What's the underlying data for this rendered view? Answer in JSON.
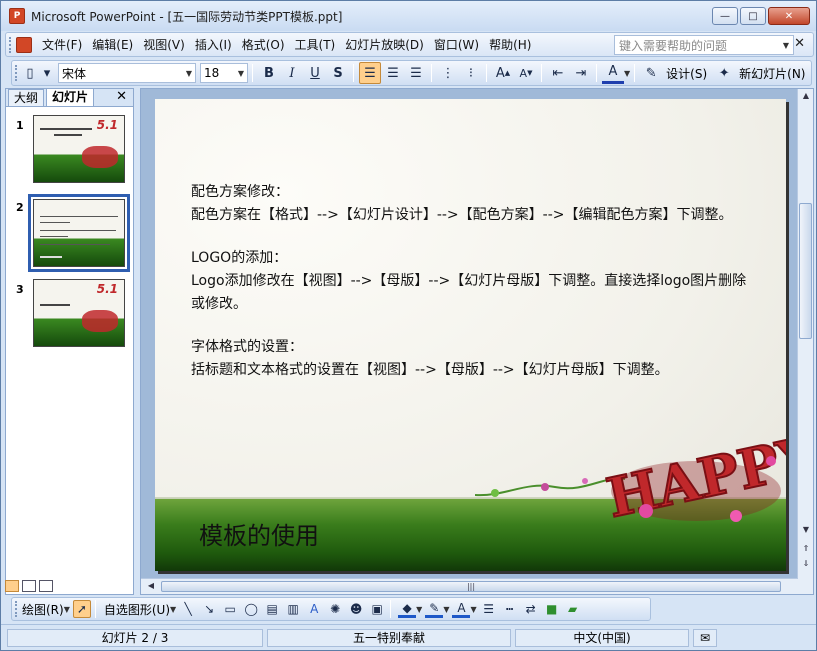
{
  "window": {
    "title": "Microsoft PowerPoint - [五一国际劳动节类PPT模板.ppt]",
    "app_icon": "P",
    "controls": {
      "minimize": "—",
      "maximize": "□",
      "close": "✕"
    }
  },
  "menubar": {
    "items": [
      "文件(F)",
      "编辑(E)",
      "视图(V)",
      "插入(I)",
      "格式(O)",
      "工具(T)",
      "幻灯片放映(D)",
      "窗口(W)",
      "帮助(H)"
    ],
    "help_placeholder": "键入需要帮助的问题",
    "close_glyph": "✕"
  },
  "toolbar": {
    "font_name": "宋体",
    "font_size": "18",
    "bold": "B",
    "italic": "I",
    "underline": "U",
    "shadow": "S",
    "design_label": "设计(S)",
    "new_slide_label": "新幻灯片(N)"
  },
  "left_panel": {
    "tab_outline": "大纲",
    "tab_slides": "幻灯片",
    "close_glyph": "✕",
    "slides": [
      {
        "num": "1",
        "badge": "5.1",
        "selected": false
      },
      {
        "num": "2",
        "badge": "",
        "selected": true
      },
      {
        "num": "3",
        "badge": "5.1",
        "selected": false
      }
    ]
  },
  "slide": {
    "paragraphs": [
      "配色方案修改：",
      "配色方案在【格式】-->【幻灯片设计】-->【配色方案】-->【编辑配色方案】下调整。",
      "",
      "LOGO的添加：",
      "Logo添加修改在【视图】-->【母版】-->【幻灯片母版】下调整。直接选择logo图片删除或修改。",
      "",
      "字体格式的设置：",
      "括标题和文本格式的设置在【视图】-->【母版】-->【幻灯片母版】下调整。"
    ],
    "footer": "模板的使用",
    "decoration_text": "HAPPY"
  },
  "drawbar": {
    "draw_label": "绘图(R)",
    "autoshape_label": "自选图形(U)"
  },
  "statusbar": {
    "slide_info": "幻灯片 2 / 3",
    "design_name": "五一特别奉献",
    "language": "中文(中国)"
  }
}
